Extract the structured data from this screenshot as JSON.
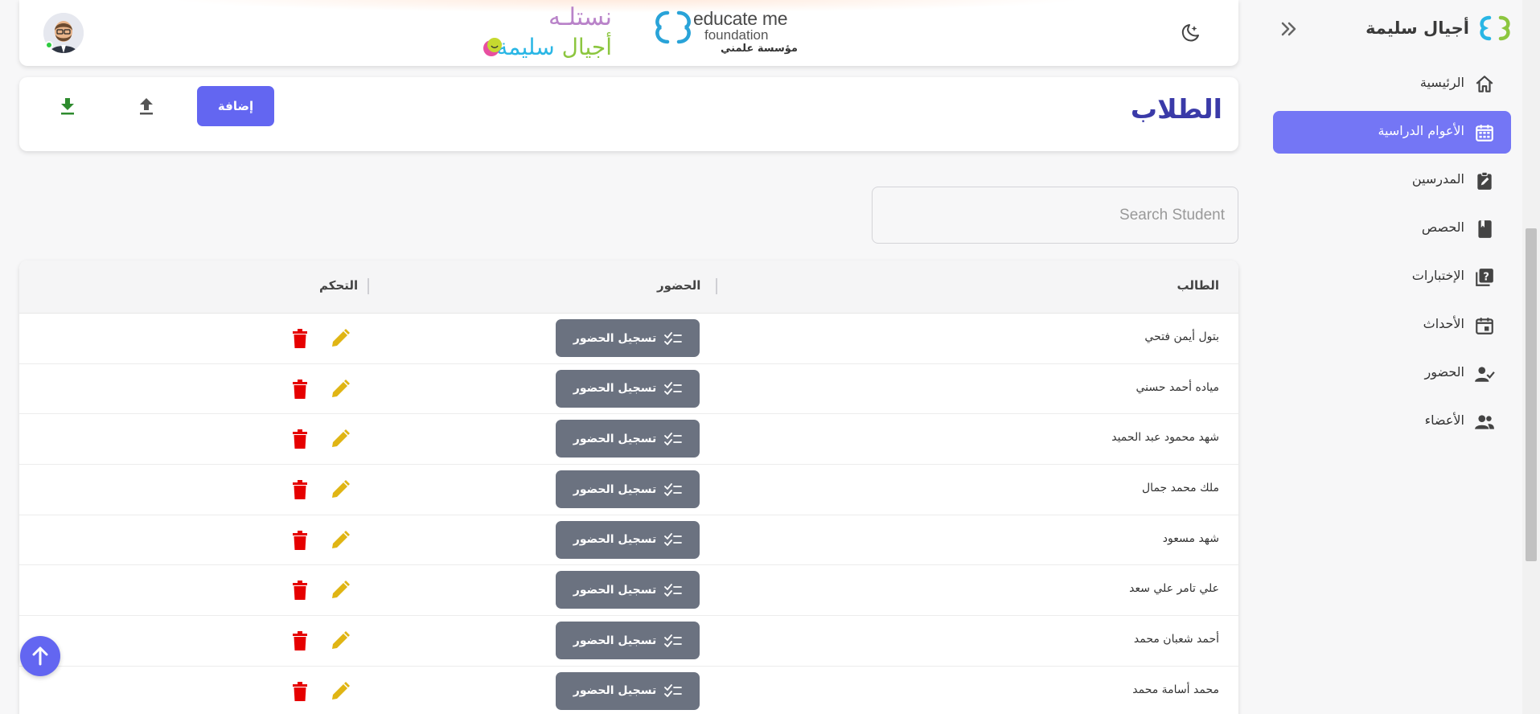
{
  "app": {
    "brand_name": "أجيال سليمة",
    "colors": {
      "accent": "#6366f1",
      "sidebar_active": "#7476f5",
      "title": "#3a3aa8",
      "attendance_button": "#6b7280",
      "edit_icon": "#e0b514",
      "delete_icon": "#e60000",
      "download_icon": "#2e8b2e",
      "online_status": "#2ecc40"
    }
  },
  "sidebar": {
    "collapse_icon": "double-chevron-right-icon",
    "items": [
      {
        "label": "الرئيسية",
        "icon": "home-icon",
        "active": false
      },
      {
        "label": "الأعوام الدراسية",
        "icon": "calendar-icon",
        "active": true
      },
      {
        "label": "المدرسين",
        "icon": "clipboard-edit-icon",
        "active": false
      },
      {
        "label": "الحصص",
        "icon": "book-icon",
        "active": false
      },
      {
        "label": "الإختبارات",
        "icon": "quiz-icon",
        "active": false
      },
      {
        "label": "الأحداث",
        "icon": "event-icon",
        "active": false
      },
      {
        "label": "الحضور",
        "icon": "user-check-icon",
        "active": false
      },
      {
        "label": "الأعضاء",
        "icon": "group-icon",
        "active": false
      }
    ]
  },
  "topbar": {
    "logo_nastala": "نستلـه",
    "logo_ajyal_part1": "أجيال",
    "logo_ajyal_part2": "سليمة",
    "educate_title": "educate me",
    "educate_subtitle": "foundation",
    "educate_arabic": "مؤسسة علمني",
    "theme_icon": "moon-star-icon",
    "avatar_icon": "user-avatar-icon"
  },
  "page": {
    "title": "الطلاب",
    "add_label": "إضافة",
    "upload_icon": "upload-icon",
    "download_icon": "download-icon"
  },
  "search": {
    "placeholder": "Search Student",
    "value": ""
  },
  "table": {
    "headers": {
      "student": "الطالب",
      "attendance": "الحضور",
      "control": "التحكم"
    },
    "attendance_button_label": "تسجيل الحضور",
    "rows": [
      {
        "name": "بتول أيمن فتحي"
      },
      {
        "name": "مياده أحمد حسني"
      },
      {
        "name": "شهد محمود عبد الحميد"
      },
      {
        "name": "ملك محمد جمال"
      },
      {
        "name": "شهد مسعود"
      },
      {
        "name": "علي تامر علي سعد"
      },
      {
        "name": "أحمد شعبان محمد"
      },
      {
        "name": "محمد أسامة محمد"
      }
    ]
  },
  "scroll_top_icon": "arrow-up-icon"
}
